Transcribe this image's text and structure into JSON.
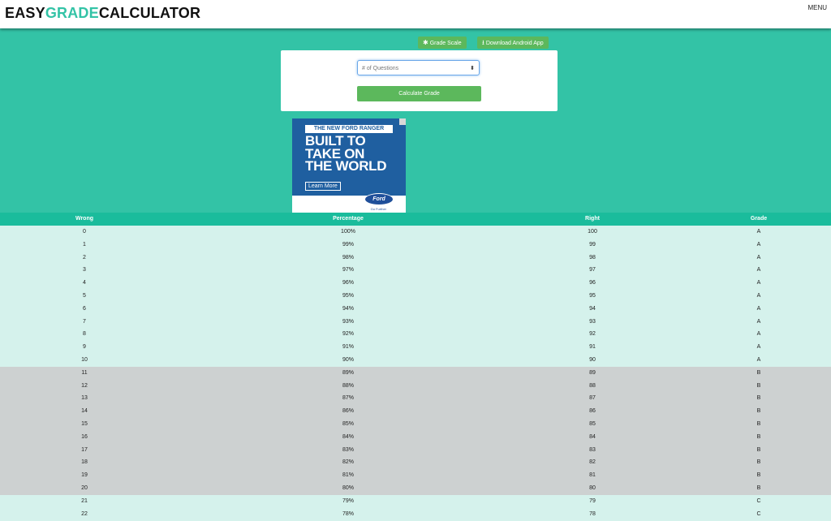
{
  "header": {
    "logo_part1": "EASY",
    "logo_part2": "GRADE",
    "logo_part3": "CALCULATOR",
    "menu_label": "MENU"
  },
  "actions": {
    "grade_scale_label": "Grade Scale",
    "download_label": "Download Android App"
  },
  "form": {
    "questions_placeholder": "# of Questions",
    "calculate_label": "Calculate Grade"
  },
  "ad": {
    "tagline": "THE NEW FORD RANGER",
    "headline_lines": [
      "BUILT TO",
      "TAKE ON",
      "THE WORLD"
    ],
    "cta": "Learn More",
    "brand": "Ford",
    "brand_slogan": "Go Further"
  },
  "table": {
    "columns": [
      "Wrong",
      "Percentage",
      "Right",
      "Grade"
    ],
    "rows": [
      [
        "0",
        "100%",
        "100",
        "A"
      ],
      [
        "1",
        "99%",
        "99",
        "A"
      ],
      [
        "2",
        "98%",
        "98",
        "A"
      ],
      [
        "3",
        "97%",
        "97",
        "A"
      ],
      [
        "4",
        "96%",
        "96",
        "A"
      ],
      [
        "5",
        "95%",
        "95",
        "A"
      ],
      [
        "6",
        "94%",
        "94",
        "A"
      ],
      [
        "7",
        "93%",
        "93",
        "A"
      ],
      [
        "8",
        "92%",
        "92",
        "A"
      ],
      [
        "9",
        "91%",
        "91",
        "A"
      ],
      [
        "10",
        "90%",
        "90",
        "A"
      ],
      [
        "11",
        "89%",
        "89",
        "B"
      ],
      [
        "12",
        "88%",
        "88",
        "B"
      ],
      [
        "13",
        "87%",
        "87",
        "B"
      ],
      [
        "14",
        "86%",
        "86",
        "B"
      ],
      [
        "15",
        "85%",
        "85",
        "B"
      ],
      [
        "16",
        "84%",
        "84",
        "B"
      ],
      [
        "17",
        "83%",
        "83",
        "B"
      ],
      [
        "18",
        "82%",
        "82",
        "B"
      ],
      [
        "19",
        "81%",
        "81",
        "B"
      ],
      [
        "20",
        "80%",
        "80",
        "B"
      ],
      [
        "21",
        "79%",
        "79",
        "C"
      ],
      [
        "22",
        "78%",
        "78",
        "C"
      ]
    ]
  },
  "colors": {
    "accent": "#33c3a6",
    "table_header": "#1abc9c",
    "button_green": "#5cb85c",
    "grade_row_colors": {
      "A": "#d5f2ec",
      "B": "#cdd1d1",
      "C": "#d5f2ec"
    }
  }
}
